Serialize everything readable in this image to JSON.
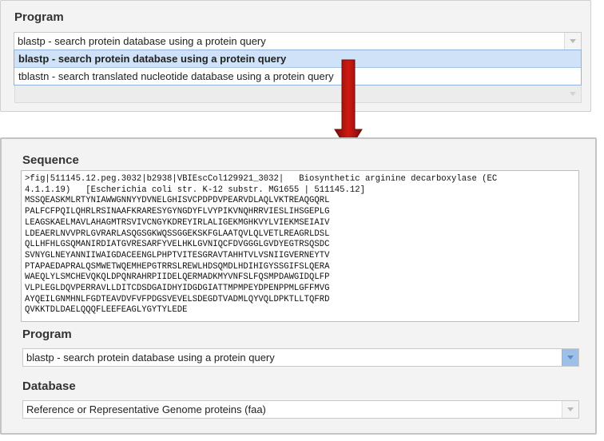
{
  "top_panel": {
    "program_label": "Program",
    "select_value": "blastp - search protein database using a protein query",
    "options": [
      "blastp - search protein database using a protein query",
      "tblastn - search translated nucleotide database using a protein query"
    ]
  },
  "bottom_panel": {
    "sequence_label": "Sequence",
    "sequence_text": ">fig|511145.12.peg.3032|b2938|VBIEscCol129921_3032|   Biosynthetic arginine decarboxylase (EC\n4.1.1.19)   [Escherichia coli str. K-12 substr. MG1655 | 511145.12]\nMSSQEASKMLRTYNIAWWGNNYYDVNELGHISVCPDPDVPEARVDLAQLVKTREAQGQRL\nPALFCFPQILQHRLRSINAAFKRARESYGYNGDYFLVYPIKVNQHRRVIESLIHSGEPLG\nLEAGSKAELMAVLAHAGMTRSVIVCNGYKDREYIRLALIGEKMGHKVYLVIEKMSEIAIV\nLDEAERLNVVPRLGVRARLASQGSGKWQSSGGEKSKFGLAATQVLQLVETLREAGRLDSL\nQLLHFHLGSQMANIRDIATGVRESARFYVELHKLGVNIQCFDVGGGLGVDYEGTRSQSDC\nSVNYGLNEYANNIIWAIGDACEENGLPHPTVITESGRAVTAHHTVLVSNIIGVERNEYTV\nPTAPAEDAPRALQSMWETWQEMHEPGTRRSLREWLHDSQMDLHDIHIGYSSGIFSLQERA\nWAEQLYLSMCHEVQKQLDPQNRAHRPIIDELQERMADKMYVNFSLFQSMPDAWGIDQLFP\nVLPLEGLDQVPERRAVLLDITCDSDGAIDHYIDGDGIATTMPMPEYDPENPPMLGFFMVG\nAYQEILGNMHNLFGDTEAVDVFVFPDGSVEVELSDEGDTVADMLQYVQLDPKTLLTQFRD\nQVKKTDLDAELQQQFLEEFEAGLYGYTYLEDE",
    "program_label": "Program",
    "program_value": "blastp - search protein database using a protein query",
    "database_label": "Database",
    "database_value": "Reference or Representative Genome proteins (faa)"
  },
  "colors": {
    "arrow": "#b5140e",
    "accent": "#9dc0e8"
  },
  "icons": {
    "dropdown": "chevron-down-icon",
    "arrow": "arrow-down-icon"
  }
}
